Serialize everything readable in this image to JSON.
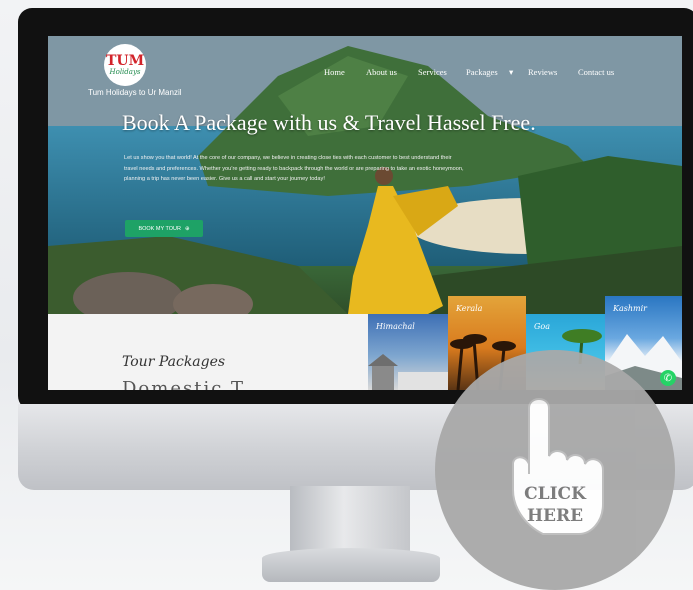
{
  "site": {
    "logo": {
      "primary": "TUM",
      "secondary": "Holidays"
    },
    "tagline": "Tum Holidays to Ur Manzil",
    "nav": [
      {
        "label": "Home"
      },
      {
        "label": "About us"
      },
      {
        "label": "Services"
      },
      {
        "label": "Packages"
      },
      {
        "label": "Reviews"
      },
      {
        "label": "Contact us"
      }
    ],
    "headline": "Book A Package with us & Travel Hassel Free.",
    "paragraph": "Let us show you that world! At the core of our company, we believe in creating close ties with each customer to best understand their travel needs and preferences. Whether you’re getting ready to backpack through the world or are preparing to take an exotic honeymoon, planning a trip has never been easier. Give us a call and start your journey today!",
    "cta": "BOOK MY TOUR",
    "section_title": "Tour Packages",
    "section_subtitle": "Domestic T",
    "cards": [
      {
        "label": "Himachal"
      },
      {
        "label": "Kerala"
      },
      {
        "label": "Goa"
      },
      {
        "label": "Kashmir"
      }
    ]
  },
  "overlay": {
    "line1": "CLICK",
    "line2": "HERE"
  },
  "colors": {
    "accent": "#1ea266",
    "whatsapp": "#25d366",
    "logo_red": "#d2232a"
  }
}
